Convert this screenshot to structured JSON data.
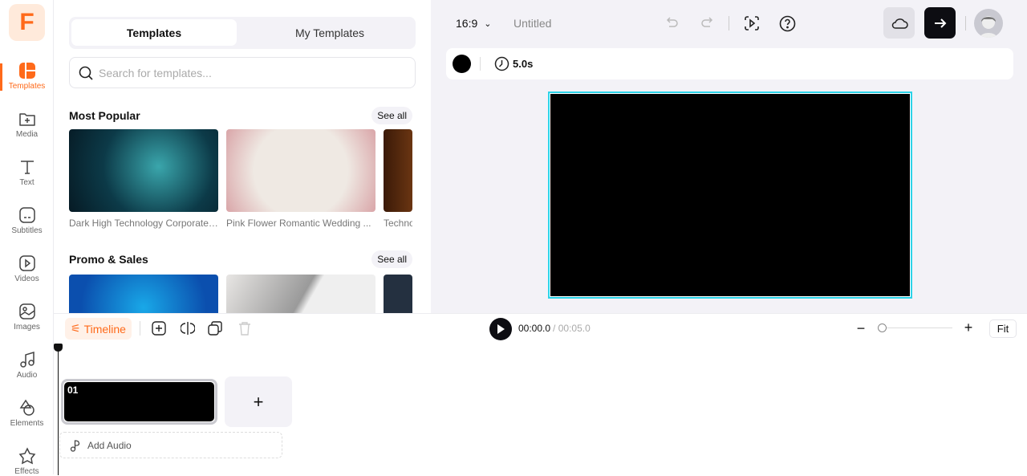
{
  "nav": {
    "logo": "F",
    "items": [
      {
        "label": "Templates",
        "icon": "templates-icon"
      },
      {
        "label": "Media",
        "icon": "folder-plus-icon"
      },
      {
        "label": "Text",
        "icon": "text-icon"
      },
      {
        "label": "Subtitles",
        "icon": "subtitles-icon"
      },
      {
        "label": "Videos",
        "icon": "video-icon"
      },
      {
        "label": "Images",
        "icon": "image-icon"
      },
      {
        "label": "Audio",
        "icon": "music-icon"
      },
      {
        "label": "Elements",
        "icon": "shapes-icon"
      },
      {
        "label": "Effects",
        "icon": "star-icon"
      }
    ]
  },
  "panel": {
    "tabs": [
      "Templates",
      "My Templates"
    ],
    "search_placeholder": "Search for templates...",
    "sections": [
      {
        "title": "Most Popular",
        "see_all": "See all",
        "items": [
          "Dark High Technology Corporate ...",
          "Pink Flower Romantic Wedding ...",
          "Techno"
        ]
      },
      {
        "title": "Promo & Sales",
        "see_all": "See all",
        "items": [
          "",
          "",
          ""
        ]
      }
    ]
  },
  "header": {
    "aspect": "16:9",
    "title": "Untitled"
  },
  "props": {
    "duration": "5.0s",
    "bg_color": "#000000"
  },
  "timeline": {
    "label": "Timeline",
    "current": "00:00.0",
    "total": "/ 00:05.0",
    "zoom_fit": "Fit",
    "zoom_level": 0.05,
    "clip_label": "01",
    "add_audio": "Add Audio"
  },
  "colors": {
    "accent": "#ff6a1a",
    "selection": "#2cd3e8"
  }
}
